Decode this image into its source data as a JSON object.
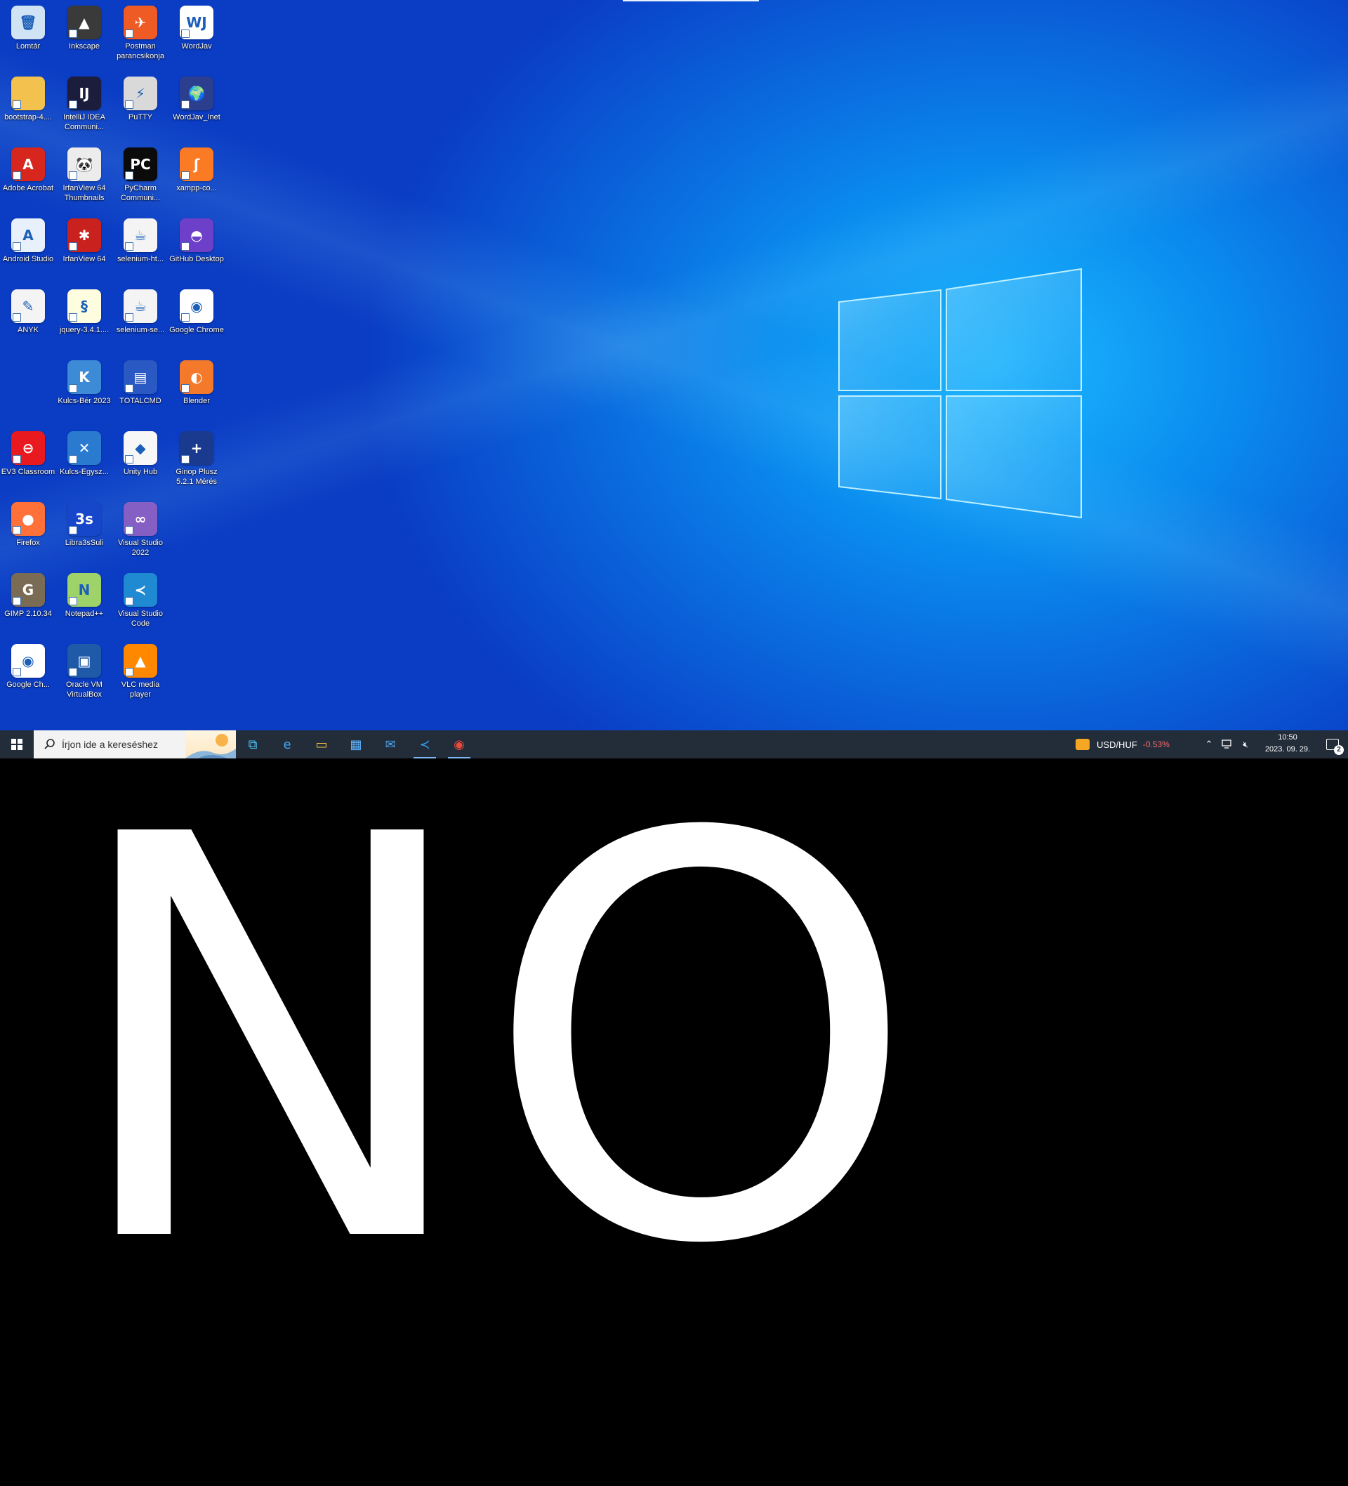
{
  "desktop": {
    "icons": [
      {
        "label": "Lomtár",
        "icon": "recycle-bin-icon",
        "color": "#cfe3f5",
        "glyph": "🗑"
      },
      {
        "label": "bootstrap-4....",
        "icon": "folder-icon",
        "color": "#f2c14e",
        "glyph": ""
      },
      {
        "label": "Adobe Acrobat",
        "icon": "adobe-acrobat-icon",
        "color": "#d7261e",
        "glyph": "A"
      },
      {
        "label": "Android Studio",
        "icon": "android-studio-icon",
        "color": "#e8f1fb",
        "glyph": "A"
      },
      {
        "label": "ANYK",
        "icon": "anyk-icon",
        "color": "#f4f4f4",
        "glyph": "✎"
      },
      {
        "label": "EV3 Classroom",
        "icon": "ev3-classroom-icon",
        "color": "#e8191f",
        "glyph": "⊖"
      },
      {
        "label": "Firefox",
        "icon": "firefox-icon",
        "color": "#ff7139",
        "glyph": "●"
      },
      {
        "label": "GIMP 2.10.34",
        "icon": "gimp-icon",
        "color": "#7a6b55",
        "glyph": "G"
      },
      {
        "label": "Google Ch...",
        "icon": "google-chrome-icon",
        "color": "#ffffff",
        "glyph": "◉"
      },
      {
        "label": "Inkscape",
        "icon": "inkscape-icon",
        "color": "#3a3a3a",
        "glyph": "▲"
      },
      {
        "label": "IntelliJ IDEA Communi...",
        "icon": "intellij-idea-icon",
        "color": "#1c1c3c",
        "glyph": "IJ"
      },
      {
        "label": "IrfanView 64 Thumbnails",
        "icon": "irfanview-thumbnails-icon",
        "color": "#ececec",
        "glyph": "🐼"
      },
      {
        "label": "IrfanView 64",
        "icon": "irfanview-icon",
        "color": "#c9221e",
        "glyph": "✱"
      },
      {
        "label": "jquery-3.4.1....",
        "icon": "script-file-icon",
        "color": "#fffde0",
        "glyph": "§"
      },
      {
        "label": "Kulcs-Bér 2023",
        "icon": "kulcs-ber-icon",
        "color": "#3d8bd6",
        "glyph": "K"
      },
      {
        "label": "Kulcs-Egysz...",
        "icon": "kulcs-egyszeru-icon",
        "color": "#2a7bd0",
        "glyph": "✕"
      },
      {
        "label": "Libra3sSuli",
        "icon": "libra3s-icon",
        "color": "#1646c9",
        "glyph": "3s"
      },
      {
        "label": "Notepad++",
        "icon": "notepad-plus-plus-icon",
        "color": "#9ed36a",
        "glyph": "N"
      },
      {
        "label": "Oracle VM VirtualBox",
        "icon": "virtualbox-icon",
        "color": "#1f5aa8",
        "glyph": "▣"
      },
      {
        "label": "Postman parancsikonja",
        "icon": "postman-icon",
        "color": "#ef5b25",
        "glyph": "✈"
      },
      {
        "label": "PuTTY",
        "icon": "putty-icon",
        "color": "#d9d9d9",
        "glyph": "⚡"
      },
      {
        "label": "PyCharm Communi...",
        "icon": "pycharm-icon",
        "color": "#0b0b0b",
        "glyph": "PC"
      },
      {
        "label": "selenium-ht...",
        "icon": "java-file-icon",
        "color": "#f4f4f4",
        "glyph": "☕"
      },
      {
        "label": "selenium-se...",
        "icon": "java-file-icon",
        "color": "#f4f4f4",
        "glyph": "☕"
      },
      {
        "label": "TOTALCMD",
        "icon": "total-commander-icon",
        "color": "#2b59c3",
        "glyph": "▤"
      },
      {
        "label": "Unity Hub",
        "icon": "unity-hub-icon",
        "color": "#f7f7f7",
        "glyph": "◆"
      },
      {
        "label": "Visual Studio 2022",
        "icon": "visual-studio-icon",
        "color": "#865fc5",
        "glyph": "∞"
      },
      {
        "label": "Visual Studio Code",
        "icon": "vscode-icon",
        "color": "#1f8ad2",
        "glyph": "≺"
      },
      {
        "label": "VLC media player",
        "icon": "vlc-icon",
        "color": "#ff8800",
        "glyph": "▲"
      },
      {
        "label": "WordJav",
        "icon": "wordjav-icon",
        "color": "#ffffff",
        "glyph": "WJ"
      },
      {
        "label": "WordJav_Inet",
        "icon": "wordjav-inet-icon",
        "color": "#2b3f8e",
        "glyph": "🌍"
      },
      {
        "label": "xampp-co...",
        "icon": "xampp-icon",
        "color": "#fb7a24",
        "glyph": "ʃ"
      },
      {
        "label": "GitHub Desktop",
        "icon": "github-desktop-icon",
        "color": "#6e40c9",
        "glyph": "◓"
      },
      {
        "label": "Google Chrome",
        "icon": "google-chrome-icon",
        "color": "#ffffff",
        "glyph": "◉"
      },
      {
        "label": "Blender",
        "icon": "blender-icon",
        "color": "#f5792a",
        "glyph": "◐"
      },
      {
        "label": "Ginop Plusz 5.2.1 Mérés",
        "icon": "ginop-plusz-icon",
        "color": "#1a3a8f",
        "glyph": "+"
      }
    ]
  },
  "taskbar": {
    "search_placeholder": "Írjon ide a kereséshez",
    "apps": [
      {
        "name": "task-view-icon",
        "glyph": "⧉"
      },
      {
        "name": "edge-icon",
        "glyph": "e"
      },
      {
        "name": "file-explorer-icon",
        "glyph": "▭"
      },
      {
        "name": "microsoft-store-icon",
        "glyph": "▦"
      },
      {
        "name": "mail-icon",
        "glyph": "✉"
      },
      {
        "name": "vscode-taskbar-icon",
        "glyph": "≺"
      },
      {
        "name": "chrome-taskbar-icon",
        "glyph": "◉"
      }
    ],
    "ticker": {
      "pair": "USD/HUF",
      "change": "-0.53%",
      "change_color": "#ff6b6b"
    },
    "clock": {
      "time": "10:50",
      "date": "2023. 09. 29."
    },
    "notification_count": "2"
  },
  "overlay_text": "NO"
}
